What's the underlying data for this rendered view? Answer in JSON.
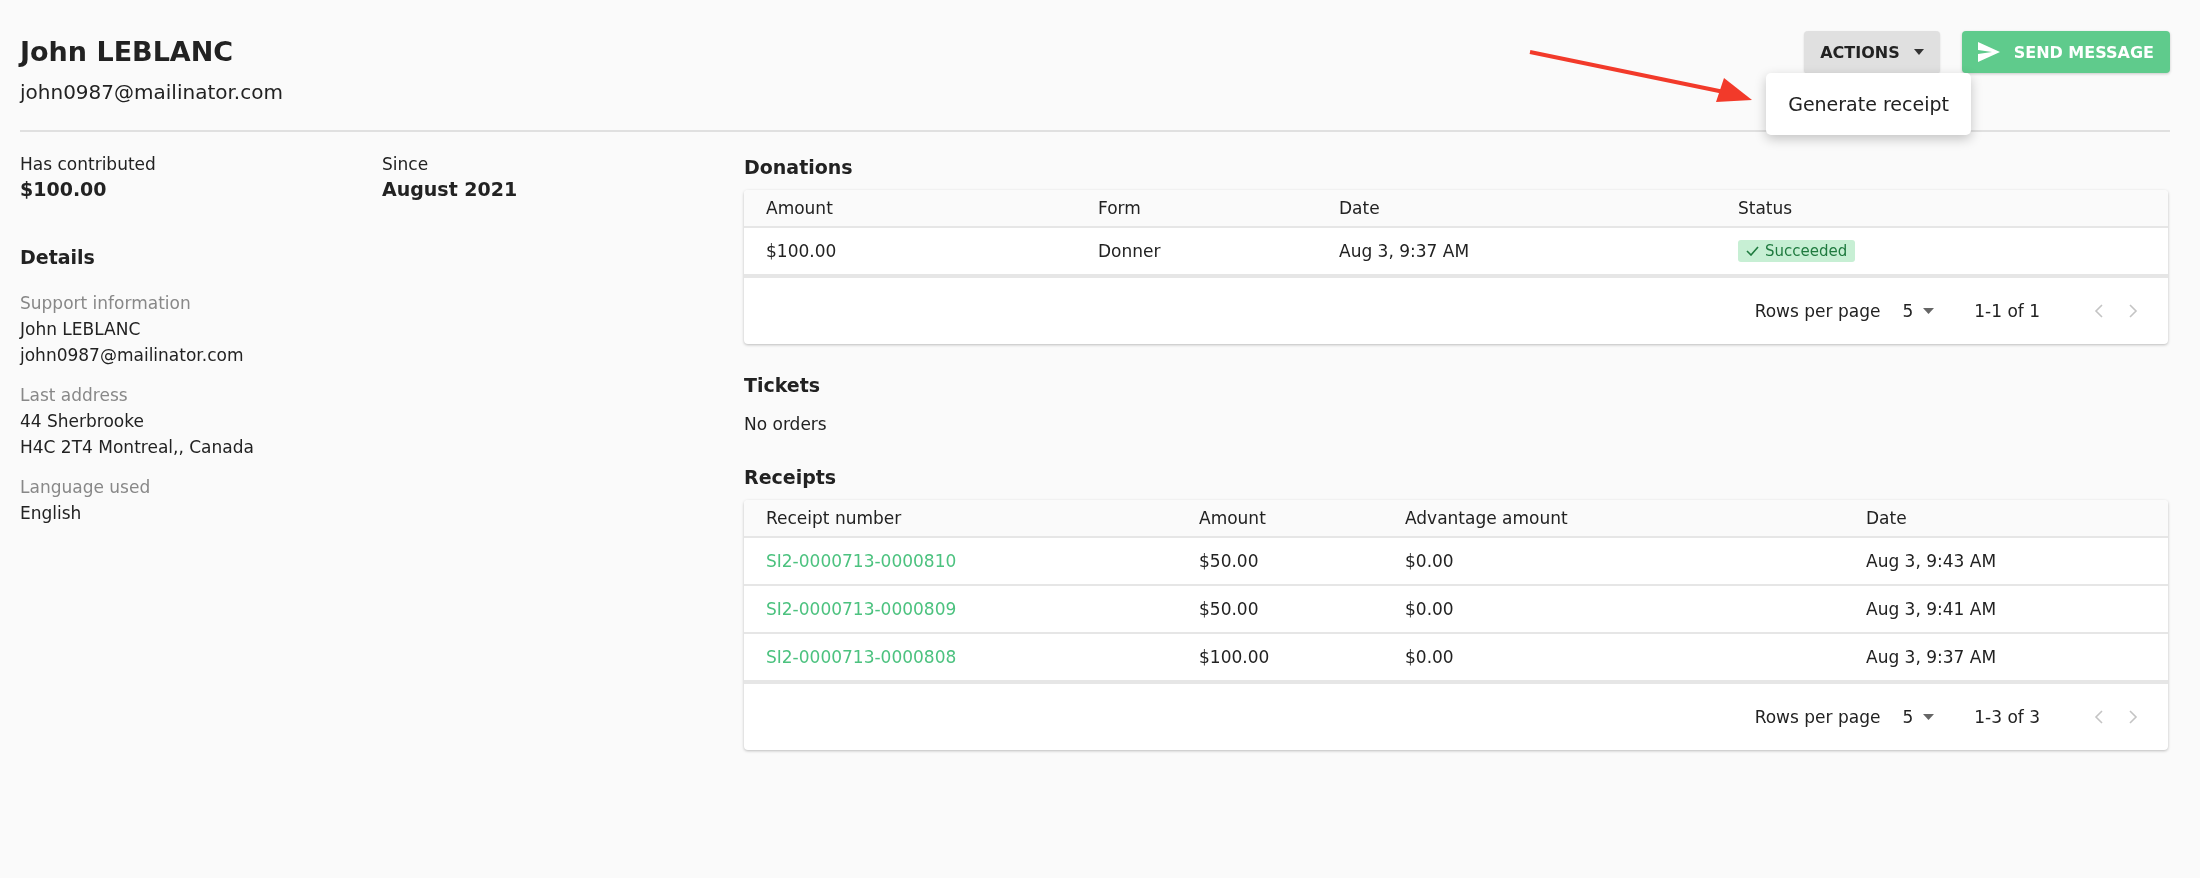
{
  "customer": {
    "name": "John LEBLANC",
    "email": "john0987@mailinator.com"
  },
  "actions": {
    "actions_button": "ACTIONS",
    "send_button": "SEND MESSAGE",
    "menu": {
      "open": true,
      "items": [
        "Generate receipt"
      ]
    }
  },
  "summary": [
    {
      "label": "Has contributed",
      "value": "$100.00"
    },
    {
      "label": "Since",
      "value": "August 2021"
    }
  ],
  "details": {
    "title": "Details",
    "sections": [
      {
        "label": "Support information",
        "lines": [
          "John LEBLANC",
          "john0987@mailinator.com"
        ]
      },
      {
        "label": "Last address",
        "lines": [
          "44 Sherbrooke",
          "H4C 2T4 Montreal,, Canada"
        ]
      },
      {
        "label": "Language used",
        "lines": [
          "English"
        ]
      }
    ]
  },
  "donations": {
    "title": "Donations",
    "columns": [
      "Amount",
      "Form",
      "Date",
      "Status"
    ],
    "rows": [
      [
        {
          "kind": "text",
          "text": "$100.00"
        },
        {
          "kind": "text",
          "text": "Donner"
        },
        {
          "kind": "text",
          "text": "Aug 3, 9:37 AM"
        },
        {
          "kind": "status",
          "text": "Succeeded"
        }
      ]
    ],
    "pagination": {
      "rows_per_page_label": "Rows per page",
      "rows_per_page": "5",
      "range": "1-1 of 1",
      "prev_disabled": true,
      "next_disabled": true
    }
  },
  "tickets": {
    "title": "Tickets",
    "empty_text": "No orders"
  },
  "receipts": {
    "title": "Receipts",
    "columns": [
      "Receipt number",
      "Amount",
      "Advantage amount",
      "Date"
    ],
    "rows": [
      [
        {
          "kind": "link",
          "text": "SI2-0000713-0000810"
        },
        {
          "kind": "text",
          "text": "$50.00"
        },
        {
          "kind": "text",
          "text": "$0.00"
        },
        {
          "kind": "text",
          "text": "Aug 3, 9:43 AM"
        }
      ],
      [
        {
          "kind": "link",
          "text": "SI2-0000713-0000809"
        },
        {
          "kind": "text",
          "text": "$50.00"
        },
        {
          "kind": "text",
          "text": "$0.00"
        },
        {
          "kind": "text",
          "text": "Aug 3, 9:41 AM"
        }
      ],
      [
        {
          "kind": "link",
          "text": "SI2-0000713-0000808"
        },
        {
          "kind": "text",
          "text": "$100.00"
        },
        {
          "kind": "text",
          "text": "$0.00"
        },
        {
          "kind": "text",
          "text": "Aug 3, 9:37 AM"
        }
      ]
    ],
    "pagination": {
      "rows_per_page_label": "Rows per page",
      "rows_per_page": "5",
      "range": "1-3 of 3",
      "prev_disabled": true,
      "next_disabled": true
    }
  }
}
